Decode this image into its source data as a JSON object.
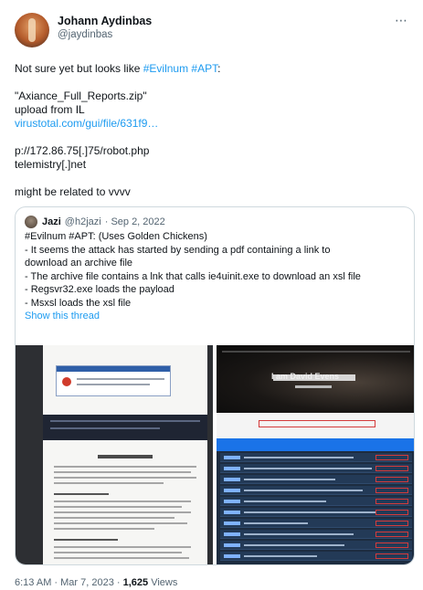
{
  "author": {
    "name": "Johann Aydinbas",
    "handle": "@jaydinbas"
  },
  "tweet": {
    "line1_prefix": "Not sure yet but looks like ",
    "line1_hashtags": "#Evilnum #APT",
    "line1_suffix": ":",
    "filename": "\"Axiance_Full_Reports.zip\"",
    "upload_from": "upload from IL",
    "vt_link": "virustotal.com/gui/file/631f9…",
    "ioc_url": "p://172.86.75[.]75/robot.php",
    "ioc_domain": "telemistry[.]net",
    "related": "might be related to vvvv"
  },
  "quote": {
    "name": "Jazi",
    "handle": "@h2jazi",
    "date": "· Sep 2, 2022",
    "lines": [
      "#Evilnum #APT: (Uses Golden Chickens)",
      "- It seems the attack has started by sending a pdf  containing a link to",
      "download an archive file",
      "- The archive file contains a lnk that calls ie4uinit.exe to download an xsl file",
      "- Regsvr32.exe loads the payload",
      "- Msxsl loads the xsl file"
    ],
    "show_thread": "Show this thread",
    "media_right_heading": "I am David Evens"
  },
  "footer": {
    "time": "6:13 AM · Mar 7, 2023 · ",
    "views_count": "1,625",
    "views_label": " Views"
  }
}
